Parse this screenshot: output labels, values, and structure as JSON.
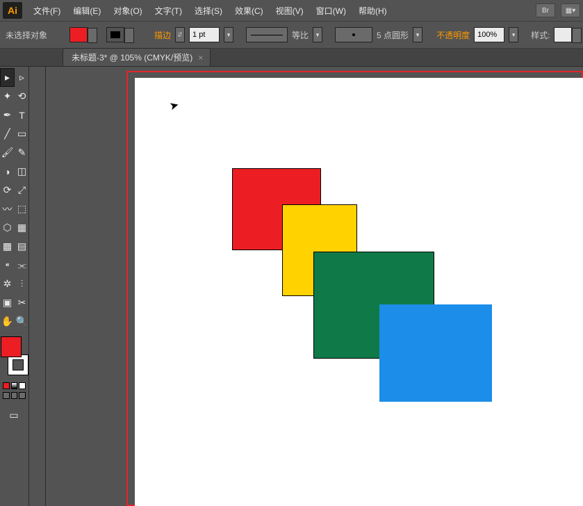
{
  "app": {
    "logo": "Ai"
  },
  "menu": {
    "file": "文件(F)",
    "edit": "编辑(E)",
    "object": "对象(O)",
    "type": "文字(T)",
    "select": "选择(S)",
    "effect": "效果(C)",
    "view": "视图(V)",
    "window": "窗口(W)",
    "help": "帮助(H)",
    "br_btn": "Br"
  },
  "options": {
    "no_selection": "未选择对象",
    "stroke_label": "描边",
    "stroke_weight": "1 pt",
    "uniform_label": "等比",
    "brush_label": "5 点圆形",
    "opacity_label": "不透明度",
    "opacity_value": "100%",
    "style_label": "样式:",
    "fill_color": "#ec1e24",
    "stroke_color": "#000000"
  },
  "tab": {
    "title": "未标题-3* @ 105% (CMYK/预览)",
    "close": "×"
  },
  "tools": {
    "names": [
      "selection",
      "direct-selection",
      "magic-wand",
      "lasso",
      "pen",
      "type",
      "line",
      "rectangle",
      "paintbrush",
      "pencil",
      "blob-brush",
      "eraser",
      "rotate",
      "scale",
      "width",
      "free-transform",
      "shape-builder",
      "perspective",
      "mesh",
      "gradient",
      "eyedropper",
      "blend",
      "symbol-sprayer",
      "graph",
      "artboard",
      "slice",
      "hand",
      "zoom"
    ]
  },
  "colors": {
    "fill": "#ec1e24",
    "stroke": "#000000"
  },
  "canvas": {
    "shapes": [
      {
        "name": "rect-red",
        "fill": "#ec1e24"
      },
      {
        "name": "rect-yellow",
        "fill": "#ffd200"
      },
      {
        "name": "rect-green",
        "fill": "#0f7a48"
      },
      {
        "name": "rect-blue",
        "fill": "#1c8de8"
      }
    ]
  }
}
